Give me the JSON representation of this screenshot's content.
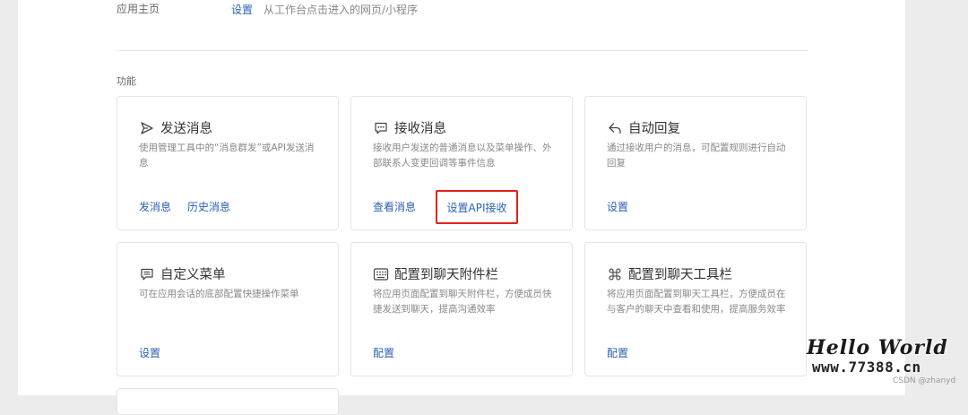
{
  "home": {
    "label": "应用主页",
    "link": "设置",
    "desc": "从工作台点击进入的网页/小程序"
  },
  "section_title": "功能",
  "cards": [
    {
      "icon": "send-icon",
      "title": "发送消息",
      "desc": "使用管理工具中的“消息群发”或API发送消息",
      "links": [
        "发消息",
        "历史消息"
      ]
    },
    {
      "icon": "chat-icon",
      "title": "接收消息",
      "desc": "接收用户发送的普通消息以及菜单操作、外部联系人变更回调等事件信息",
      "links": [
        "查看消息",
        "设置API接收"
      ]
    },
    {
      "icon": "reply-icon",
      "title": "自动回复",
      "desc": "通过接收用户的消息，可配置规则进行自动回复",
      "links": [
        "设置"
      ]
    },
    {
      "icon": "menu-icon",
      "title": "自定义菜单",
      "desc": "可在应用会话的底部配置快捷操作菜单",
      "links": [
        "设置"
      ]
    },
    {
      "icon": "attachment-bar-icon",
      "title": "配置到聊天附件栏",
      "desc": "将应用页面配置到聊天附件栏，方便成员快捷发送到聊天，提高沟通效率",
      "links": [
        "配置"
      ]
    },
    {
      "icon": "toolbar-icon",
      "title": "配置到聊天工具栏",
      "desc": "将应用页面配置到聊天工具栏，方便成员在与客户的聊天中查看和使用，提高服务效率",
      "links": [
        "配置"
      ]
    }
  ],
  "highlight_color": "#e0241b",
  "link_color": "#2a62b4",
  "watermark": {
    "title": "Hello World",
    "url": "www.77388.cn",
    "credit": "CSDN @zhanyd"
  }
}
